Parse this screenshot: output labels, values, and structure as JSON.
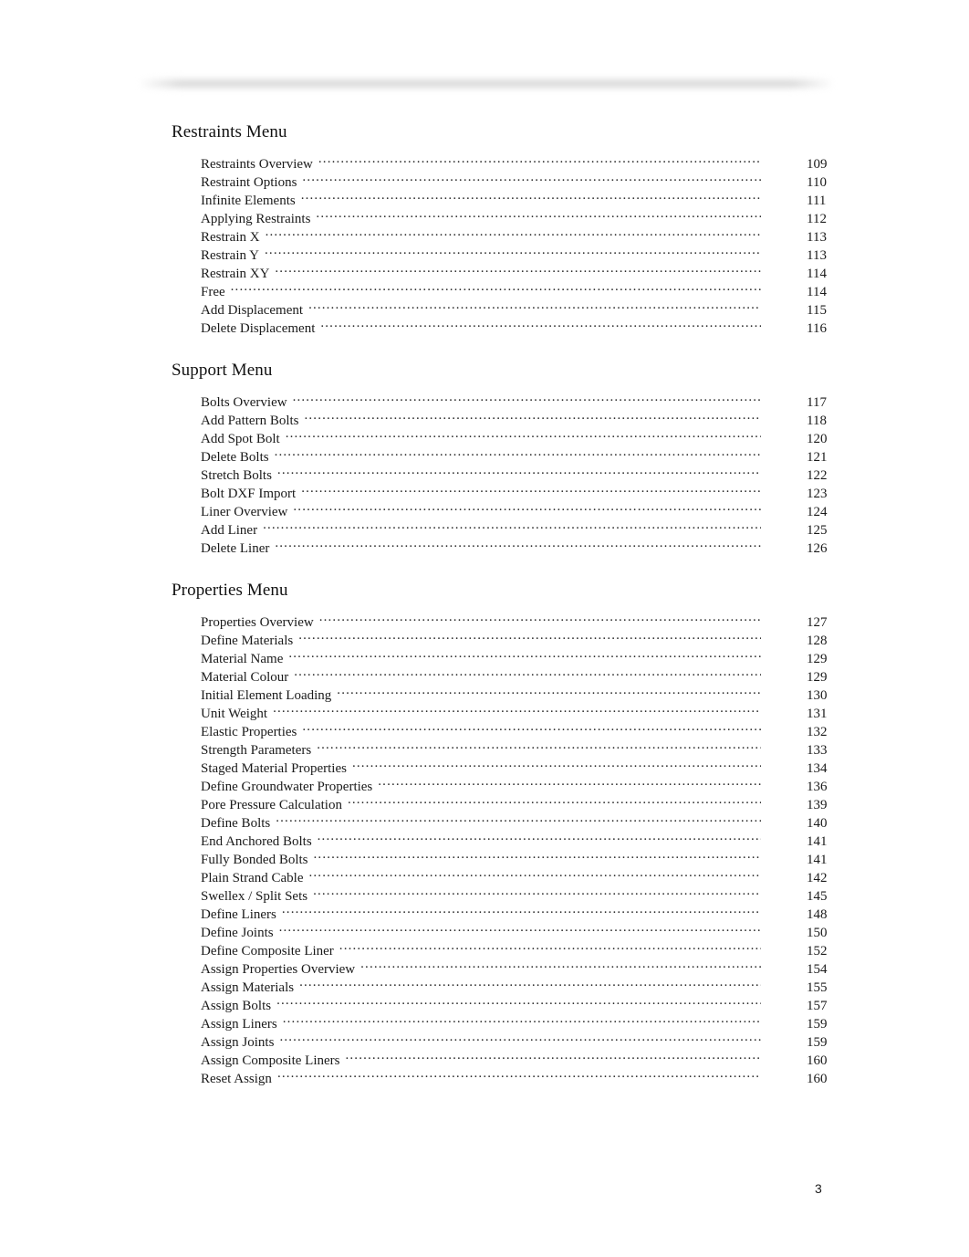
{
  "document": {
    "page_number": "3"
  },
  "sections": [
    {
      "heading": "Restraints Menu",
      "entries": [
        {
          "title": "Restraints Overview",
          "page": "109"
        },
        {
          "title": "Restraint Options",
          "page": "110"
        },
        {
          "title": "Infinite Elements",
          "page": "111"
        },
        {
          "title": "Applying Restraints",
          "page": "112"
        },
        {
          "title": "Restrain X",
          "page": "113"
        },
        {
          "title": "Restrain Y",
          "page": "113"
        },
        {
          "title": "Restrain XY",
          "page": "114"
        },
        {
          "title": "Free",
          "page": "114"
        },
        {
          "title": "Add Displacement",
          "page": "115"
        },
        {
          "title": "Delete Displacement",
          "page": "116"
        }
      ]
    },
    {
      "heading": "Support Menu",
      "entries": [
        {
          "title": "Bolts Overview",
          "page": "117"
        },
        {
          "title": "Add Pattern Bolts",
          "page": "118"
        },
        {
          "title": "Add Spot Bolt",
          "page": "120"
        },
        {
          "title": "Delete Bolts",
          "page": "121"
        },
        {
          "title": "Stretch Bolts",
          "page": "122"
        },
        {
          "title": "Bolt DXF Import",
          "page": "123"
        },
        {
          "title": "Liner Overview",
          "page": "124"
        },
        {
          "title": "Add Liner",
          "page": "125"
        },
        {
          "title": "Delete Liner",
          "page": "126"
        }
      ]
    },
    {
      "heading": "Properties Menu",
      "entries": [
        {
          "title": "Properties Overview",
          "page": "127"
        },
        {
          "title": "Define Materials",
          "page": "128"
        },
        {
          "title": "Material Name",
          "page": "129"
        },
        {
          "title": "Material Colour",
          "page": "129"
        },
        {
          "title": "Initial Element Loading",
          "page": "130"
        },
        {
          "title": "Unit Weight",
          "page": "131"
        },
        {
          "title": "Elastic Properties",
          "page": "132"
        },
        {
          "title": "Strength Parameters",
          "page": "133"
        },
        {
          "title": "Staged Material Properties",
          "page": "134"
        },
        {
          "title": "Define Groundwater Properties",
          "page": "136"
        },
        {
          "title": "Pore Pressure Calculation",
          "page": "139"
        },
        {
          "title": "Define Bolts",
          "page": "140"
        },
        {
          "title": "End Anchored Bolts",
          "page": "141"
        },
        {
          "title": "Fully Bonded Bolts",
          "page": "141"
        },
        {
          "title": "Plain Strand Cable",
          "page": "142"
        },
        {
          "title": "Swellex / Split Sets",
          "page": "145"
        },
        {
          "title": "Define Liners",
          "page": "148"
        },
        {
          "title": "Define Joints",
          "page": "150"
        },
        {
          "title": "Define Composite Liner",
          "page": "152"
        },
        {
          "title": "Assign Properties Overview",
          "page": "154"
        },
        {
          "title": "Assign Materials",
          "page": "155"
        },
        {
          "title": "Assign Bolts",
          "page": "157"
        },
        {
          "title": "Assign Liners",
          "page": "159"
        },
        {
          "title": "Assign Joints",
          "page": "159"
        },
        {
          "title": "Assign Composite Liners",
          "page": "160"
        },
        {
          "title": "Reset Assign",
          "page": "160"
        }
      ]
    }
  ]
}
